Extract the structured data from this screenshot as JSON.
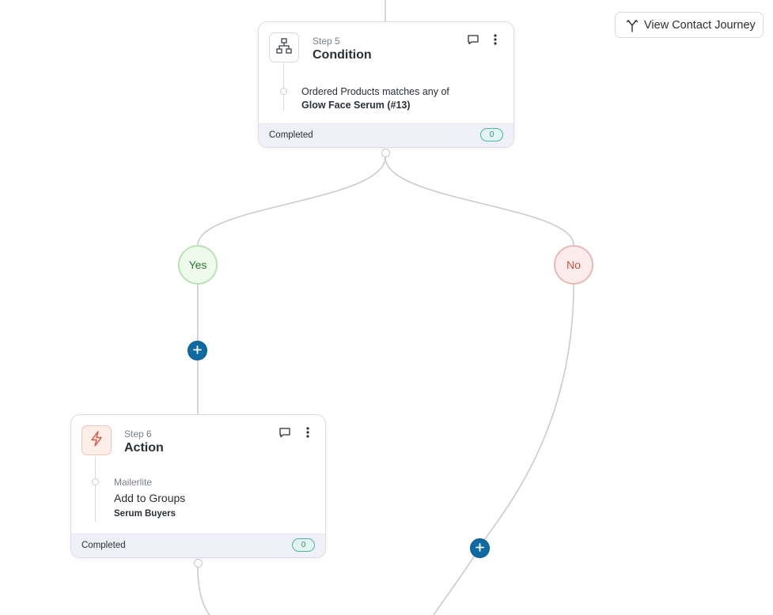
{
  "toolbar": {
    "view_journey_label": "View Contact Journey"
  },
  "nodes": {
    "condition": {
      "step_label": "Step 5",
      "title": "Condition",
      "rule_text": "Ordered Products matches any of",
      "rule_value": "Glow Face Serum (#13)",
      "status": "Completed",
      "count": "0",
      "icon": "hierarchy-icon"
    },
    "action": {
      "step_label": "Step 6",
      "title": "Action",
      "integration": "Mailerlite",
      "action_name": "Add to Groups",
      "action_value": "Serum Buyers",
      "status": "Completed",
      "count": "0",
      "icon": "lightning-icon"
    }
  },
  "branches": {
    "yes_label": "Yes",
    "no_label": "No"
  },
  "colors": {
    "accent_blue": "#0f6aa3",
    "yes_green": "#2c7a2c",
    "no_red": "#c9503e",
    "count_teal": "#46b6a3",
    "action_icon_red": "#d9543f"
  }
}
